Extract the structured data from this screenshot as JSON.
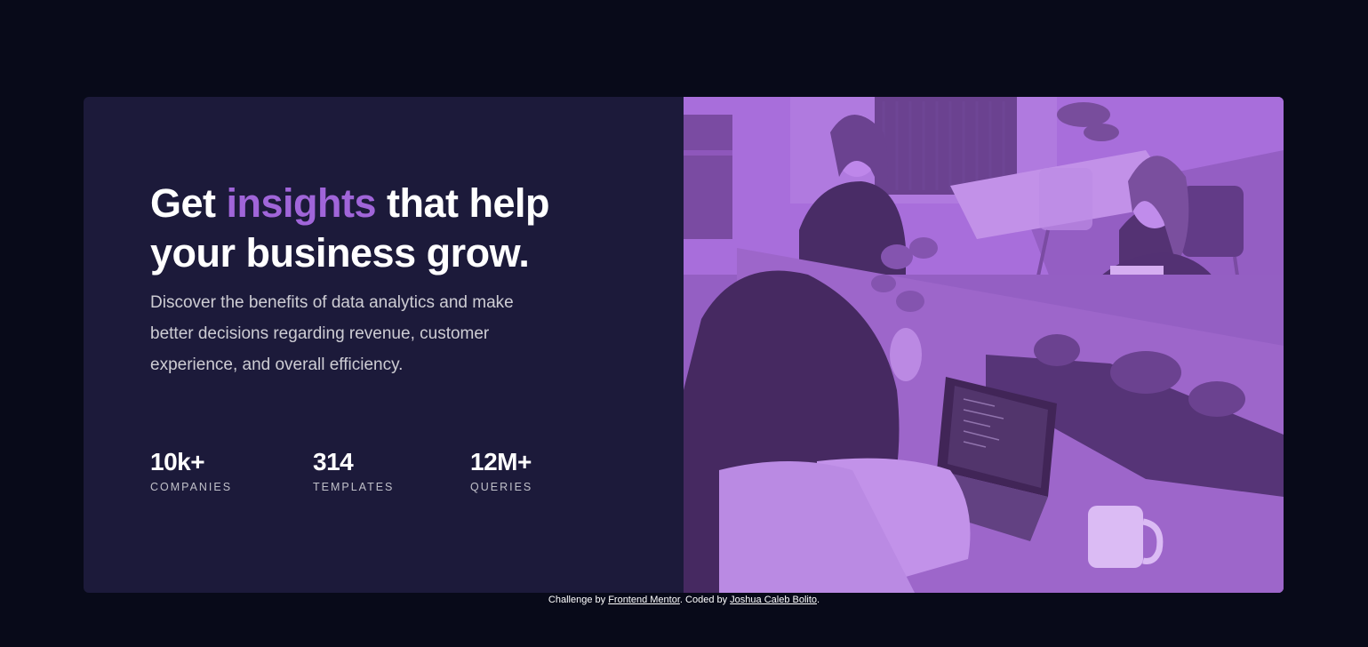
{
  "hero": {
    "headline_pre": "Get ",
    "headline_accent": "insights",
    "headline_post": " that help your business grow.",
    "description": "Discover the benefits of data analytics and make better decisions regarding revenue, customer experience, and overall efficiency."
  },
  "stats": [
    {
      "value": "10k+",
      "label": "COMPANIES"
    },
    {
      "value": "314",
      "label": "TEMPLATES"
    },
    {
      "value": "12M+",
      "label": "QUERIES"
    }
  ],
  "footer": {
    "challenge_text": "Challenge by ",
    "frontend_mentor_link": "Frontend Mentor",
    "coded_by_text": ". Coded by ",
    "author_link": "Joshua Caleb Bolito",
    "end_text": "."
  },
  "colors": {
    "background": "#080a19",
    "card": "#1c1a3a",
    "accent": "#a065d9",
    "image_overlay": "#aa5cdb"
  }
}
